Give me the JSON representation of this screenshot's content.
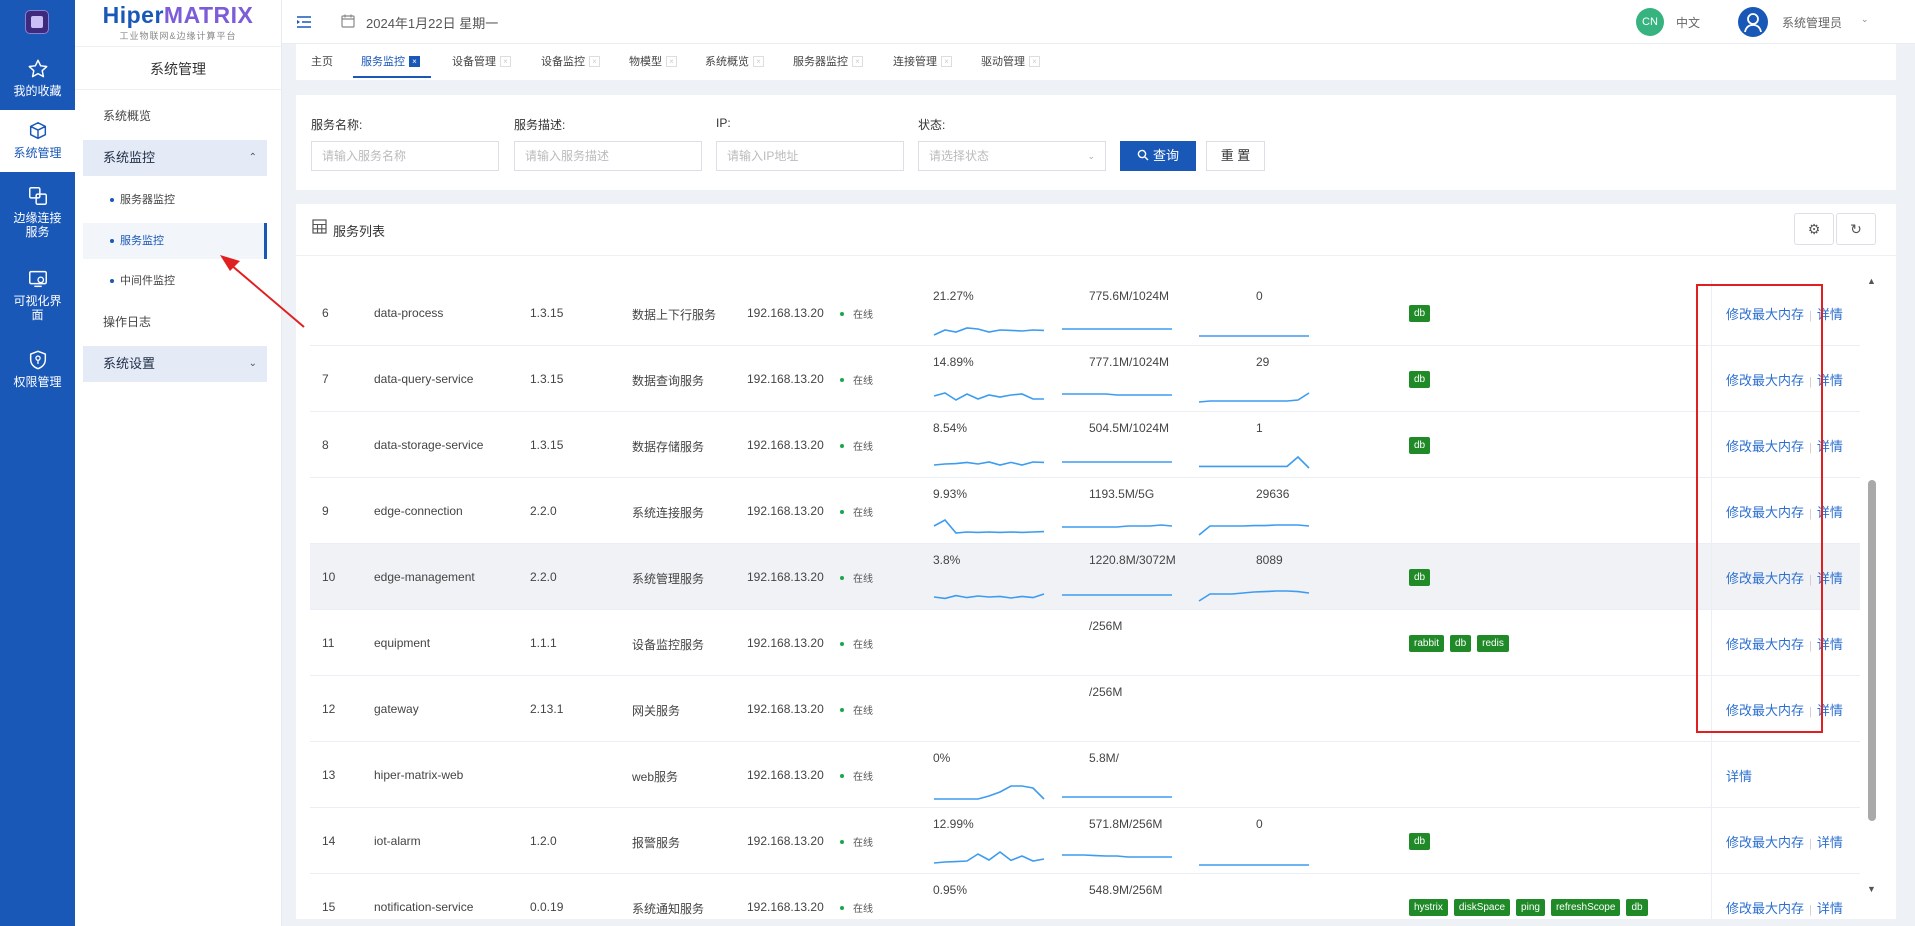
{
  "rail": {
    "items": [
      {
        "label": "我的收藏",
        "icon": "star-icon"
      },
      {
        "label": "系统管理",
        "icon": "cube-icon"
      },
      {
        "label": "边缘连接服务",
        "icon": "link-squares-icon"
      },
      {
        "label": "可视化界面",
        "icon": "monitor-eye-icon"
      },
      {
        "label": "权限管理",
        "icon": "shield-icon"
      }
    ]
  },
  "brand": {
    "name_a": "Hiper",
    "name_b": "MATRIX",
    "subtitle": "工业物联网&边缘计算平台"
  },
  "nav": {
    "title": "系统管理",
    "overview": "系统概览",
    "monitor_group": "系统监控",
    "monitor_items": [
      "服务器监控",
      "服务监控",
      "中间件监控"
    ],
    "log": "操作日志",
    "settings": "系统设置"
  },
  "header": {
    "date": "2024年1月22日 星期一",
    "lang_badge": "CN",
    "lang": "中文",
    "user": "系统管理员"
  },
  "tabs": [
    "主页",
    "服务监控",
    "设备管理",
    "设备监控",
    "物模型",
    "系统概览",
    "服务器监控",
    "连接管理",
    "驱动管理"
  ],
  "filter": {
    "name_label": "服务名称:",
    "name_placeholder": "请输入服务名称",
    "desc_label": "服务描述:",
    "desc_placeholder": "请输入服务描述",
    "ip_label": "IP:",
    "ip_placeholder": "请输入IP地址",
    "status_label": "状态:",
    "status_placeholder": "请选择状态",
    "query": "查询",
    "reset": "重 置"
  },
  "list": {
    "title": "服务列表"
  },
  "ops": {
    "modify": "修改最大内存",
    "detail": "详情"
  },
  "accent": "#1a58b8",
  "rows": [
    {
      "idx": "6",
      "name": "data-process",
      "ver": "1.3.15",
      "desc": "数据上下行服务",
      "ip": "192.168.13.20",
      "status": "在线",
      "cpu": "21.27%",
      "mem": "775.6M/1024M",
      "thr": "0",
      "tags": [
        "db"
      ],
      "modify": true
    },
    {
      "idx": "7",
      "name": "data-query-service",
      "ver": "1.3.15",
      "desc": "数据查询服务",
      "ip": "192.168.13.20",
      "status": "在线",
      "cpu": "14.89%",
      "mem": "777.1M/1024M",
      "thr": "29",
      "tags": [
        "db"
      ],
      "modify": true
    },
    {
      "idx": "8",
      "name": "data-storage-service",
      "ver": "1.3.15",
      "desc": "数据存储服务",
      "ip": "192.168.13.20",
      "status": "在线",
      "cpu": "8.54%",
      "mem": "504.5M/1024M",
      "thr": "1",
      "tags": [
        "db"
      ],
      "modify": true
    },
    {
      "idx": "9",
      "name": "edge-connection",
      "ver": "2.2.0",
      "desc": "系统连接服务",
      "ip": "192.168.13.20",
      "status": "在线",
      "cpu": "9.93%",
      "mem": "1193.5M/5G",
      "thr": "29636",
      "tags": [],
      "modify": true
    },
    {
      "idx": "10",
      "name": "edge-management",
      "ver": "2.2.0",
      "desc": "系统管理服务",
      "ip": "192.168.13.20",
      "status": "在线",
      "cpu": "3.8%",
      "mem": "1220.8M/3072M",
      "thr": "8089",
      "tags": [
        "db"
      ],
      "modify": true
    },
    {
      "idx": "11",
      "name": "equipment",
      "ver": "1.1.1",
      "desc": "设备监控服务",
      "ip": "192.168.13.20",
      "status": "在线",
      "cpu": "",
      "mem": "/256M",
      "thr": "",
      "tags": [
        "rabbit",
        "db",
        "redis"
      ],
      "modify": true
    },
    {
      "idx": "12",
      "name": "gateway",
      "ver": "2.13.1",
      "desc": "网关服务",
      "ip": "192.168.13.20",
      "status": "在线",
      "cpu": "",
      "mem": "/256M",
      "thr": "",
      "tags": [],
      "modify": true
    },
    {
      "idx": "13",
      "name": "hiper-matrix-web",
      "ver": "",
      "desc": "web服务",
      "ip": "192.168.13.20",
      "status": "在线",
      "cpu": "0%",
      "mem": "5.8M/",
      "thr": "",
      "tags": [],
      "modify": false
    },
    {
      "idx": "14",
      "name": "iot-alarm",
      "ver": "1.2.0",
      "desc": "报警服务",
      "ip": "192.168.13.20",
      "status": "在线",
      "cpu": "12.99%",
      "mem": "571.8M/256M",
      "thr": "0",
      "tags": [
        "db"
      ],
      "modify": true
    },
    {
      "idx": "15",
      "name": "notification-service",
      "ver": "0.0.19",
      "desc": "系统通知服务",
      "ip": "192.168.13.20",
      "status": "在线",
      "cpu": "0.95%",
      "mem": "548.9M/256M",
      "thr": "",
      "tags": [
        "hystrix",
        "diskSpace",
        "ping",
        "refreshScope",
        "db"
      ],
      "modify": true
    }
  ]
}
